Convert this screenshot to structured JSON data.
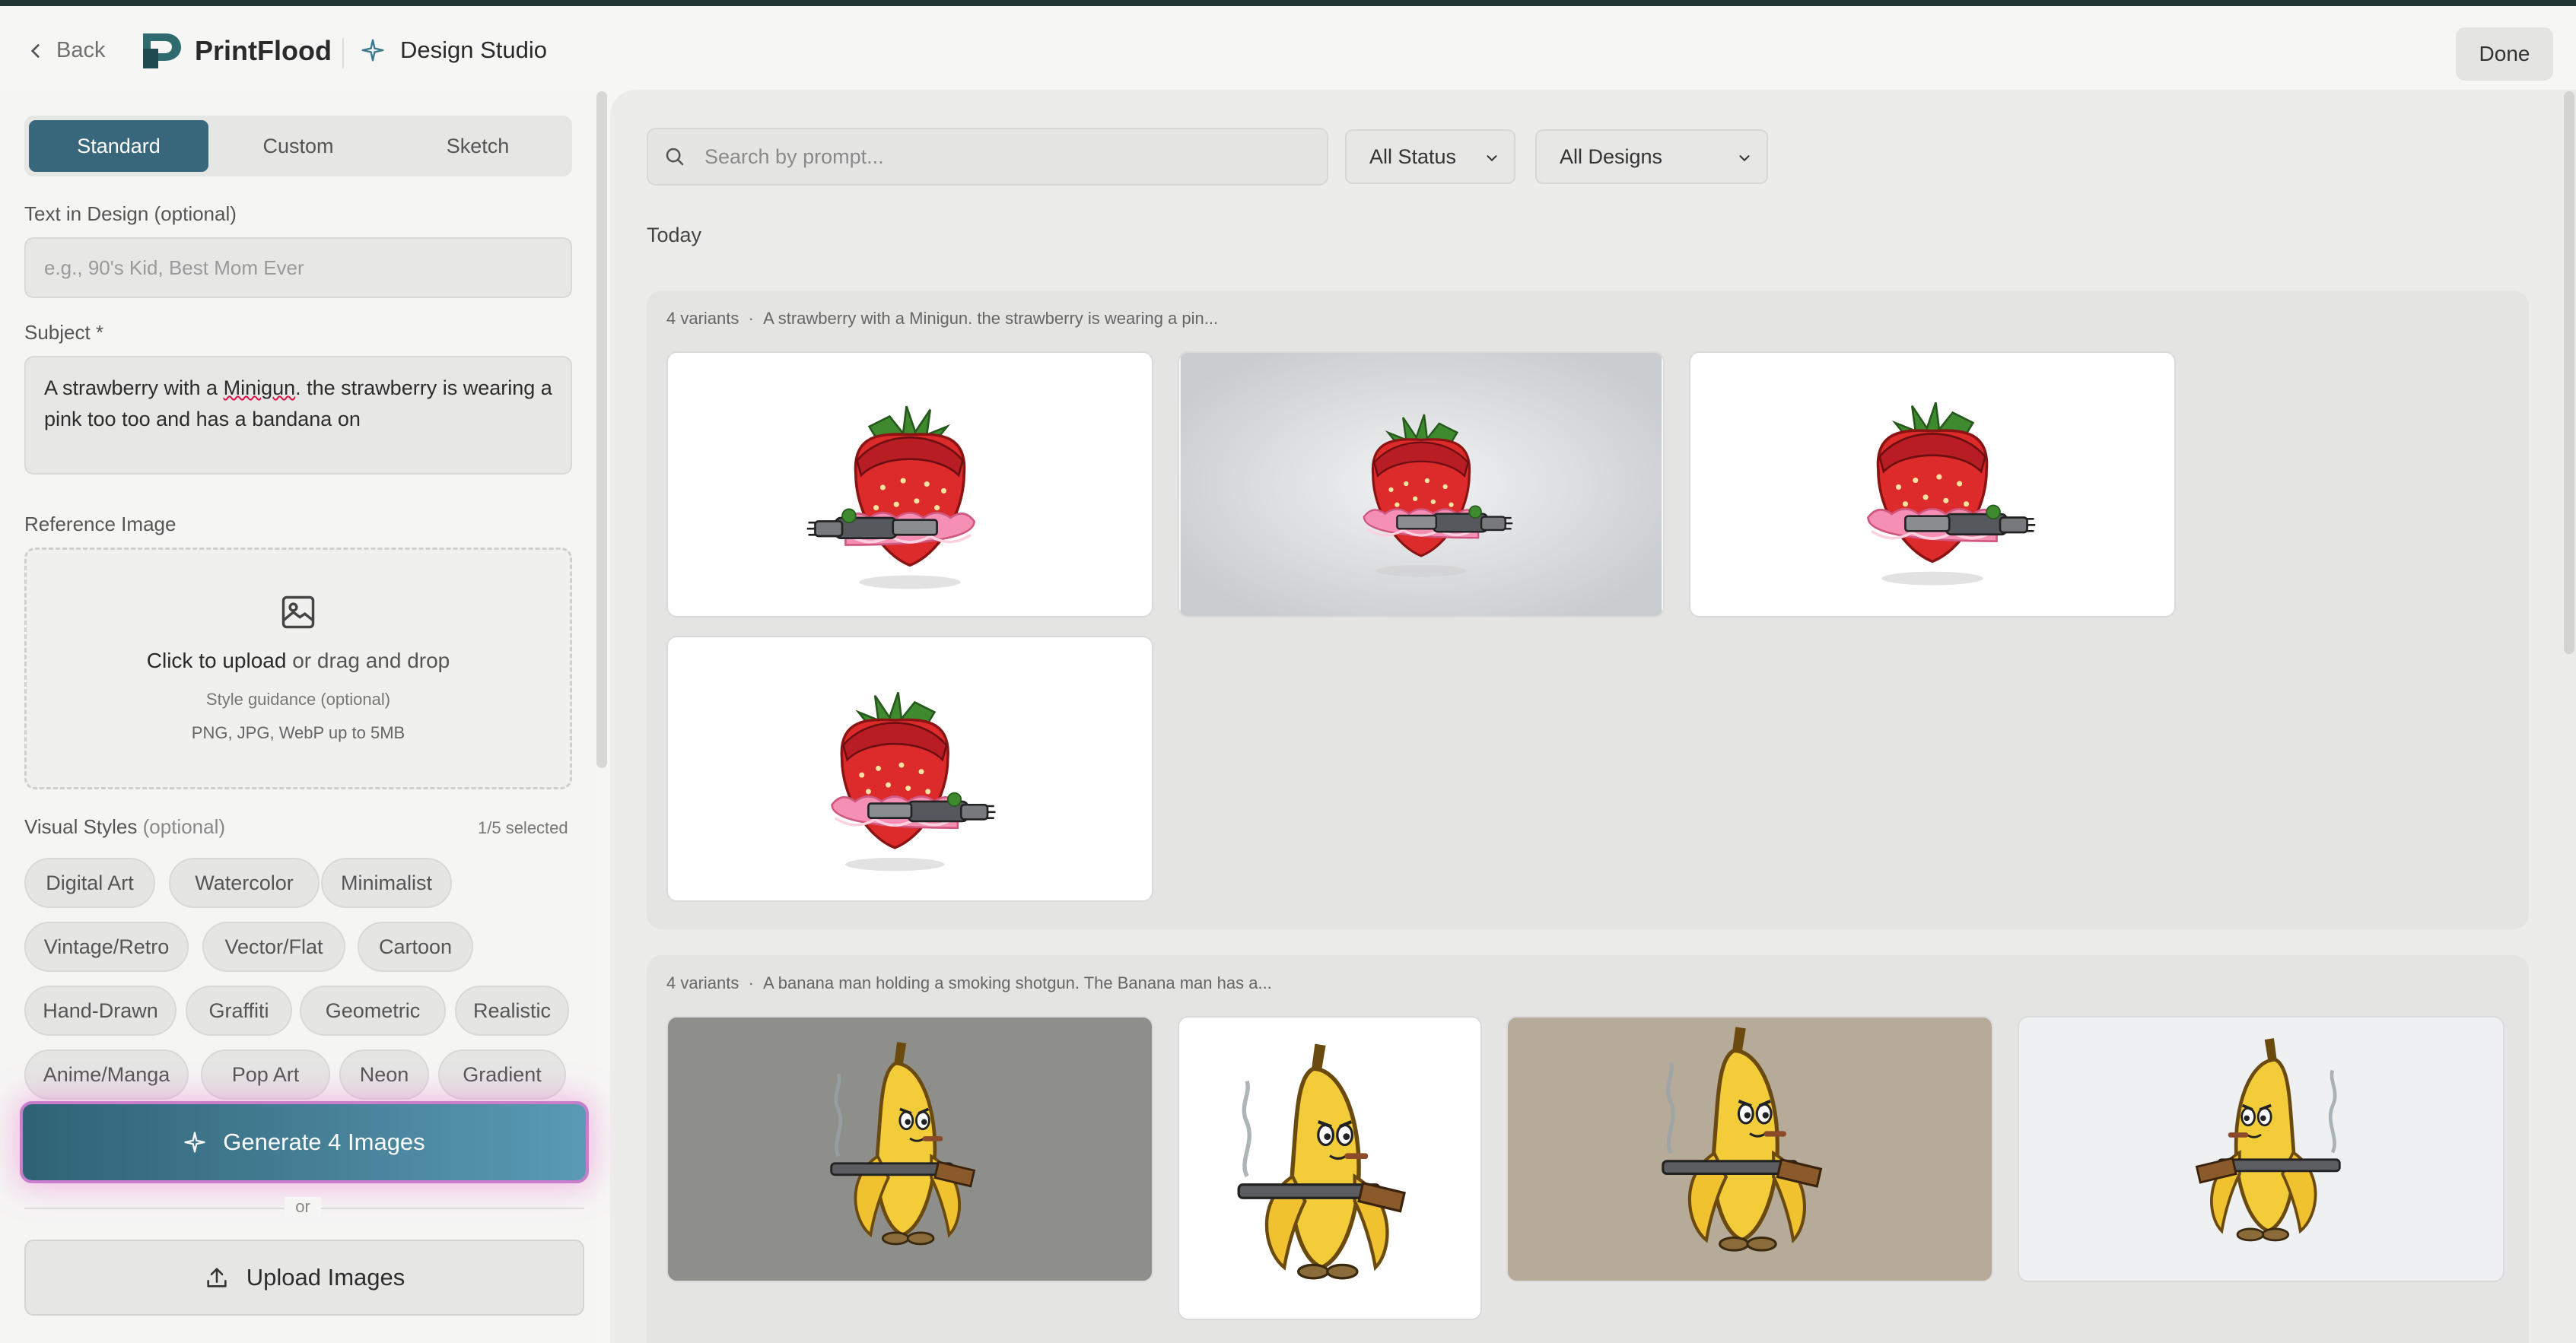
{
  "header": {
    "back_label": "Back",
    "brand": "PrintFlood",
    "section_title": "Design Studio",
    "done_label": "Done"
  },
  "sidebar": {
    "tabs": [
      {
        "label": "Standard",
        "active": true
      },
      {
        "label": "Custom",
        "active": false
      },
      {
        "label": "Sketch",
        "active": false
      }
    ],
    "text_in_design": {
      "label": "Text in Design (optional)",
      "placeholder": "e.g., 90's Kid, Best Mom Ever",
      "value": ""
    },
    "subject": {
      "label": "Subject *",
      "value_before": "A strawberry with a ",
      "value_flagged": "Minigun",
      "value_after": ". the strawberry is wearing a pink too too and has a bandana on"
    },
    "reference_image": {
      "label": "Reference Image",
      "click_text": "Click to upload",
      "drag_text": " or drag and drop",
      "hint": "Style guidance (optional)",
      "formats": "PNG, JPG, WebP up to 5MB"
    },
    "visual_styles": {
      "label": "Visual Styles",
      "optional": "(optional)",
      "count": "1/5 selected",
      "chips": [
        "Digital Art",
        "Watercolor",
        "Minimalist",
        "Vintage/Retro",
        "Vector/Flat",
        "Cartoon",
        "Hand-Drawn",
        "Graffiti",
        "Geometric",
        "Realistic",
        "Anime/Manga",
        "Pop Art",
        "Neon",
        "Gradient"
      ]
    },
    "generate_label": "Generate 4 Images",
    "or_label": "or",
    "upload_label": "Upload Images"
  },
  "main": {
    "search_placeholder": "Search by prompt...",
    "status_filter": "All Status",
    "design_filter": "All Designs",
    "date_heading": "Today",
    "groups": [
      {
        "variants": "4 variants",
        "prompt": "A strawberry with a Minigun. the strawberry is wearing a pin..."
      },
      {
        "variants": "4 variants",
        "prompt": "A banana man holding a smoking shotgun. The Banana man has a..."
      }
    ]
  },
  "colors": {
    "accent": "#38677c",
    "generate_gradient_start": "#2f6275",
    "generate_gradient_end": "#5a9ab5",
    "glow": "#ee82d2",
    "top_strip": "#223734"
  },
  "icons": [
    "chevron-left-icon",
    "printflood-logo",
    "sparkle-icon",
    "search-icon",
    "chevron-down-icon",
    "image-icon",
    "upload-icon"
  ]
}
